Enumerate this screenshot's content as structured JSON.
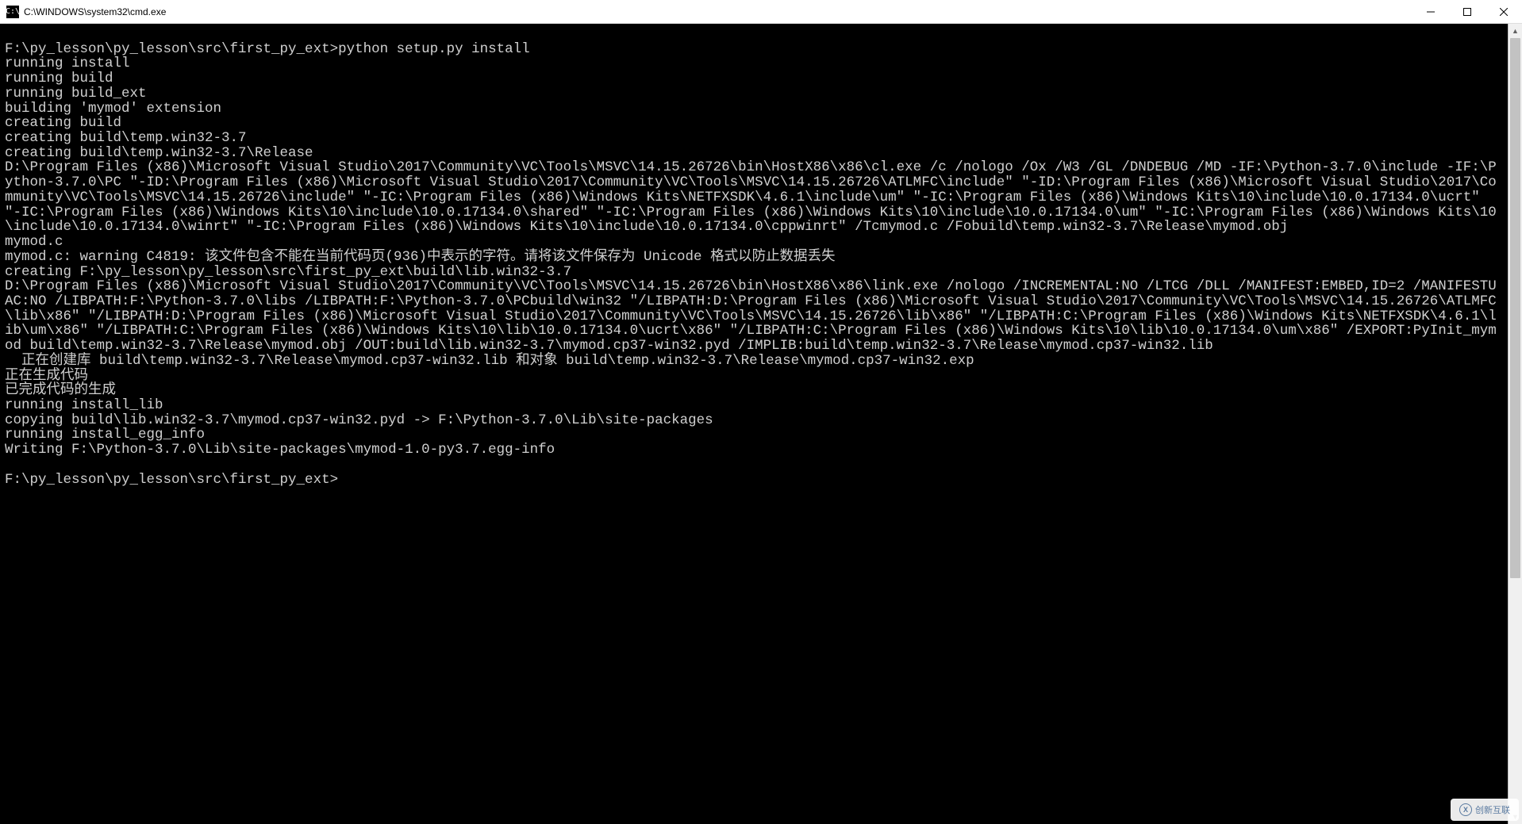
{
  "window": {
    "title": "C:\\WINDOWS\\system32\\cmd.exe",
    "icon_text": "C:\\"
  },
  "terminal": {
    "lines": [
      "",
      "F:\\py_lesson\\py_lesson\\src\\first_py_ext>python setup.py install",
      "running install",
      "running build",
      "running build_ext",
      "building 'mymod' extension",
      "creating build",
      "creating build\\temp.win32-3.7",
      "creating build\\temp.win32-3.7\\Release",
      "D:\\Program Files (x86)\\Microsoft Visual Studio\\2017\\Community\\VC\\Tools\\MSVC\\14.15.26726\\bin\\HostX86\\x86\\cl.exe /c /nologo /Ox /W3 /GL /DNDEBUG /MD -IF:\\Python-3.7.0\\include -IF:\\Python-3.7.0\\PC \"-ID:\\Program Files (x86)\\Microsoft Visual Studio\\2017\\Community\\VC\\Tools\\MSVC\\14.15.26726\\ATLMFC\\include\" \"-ID:\\Program Files (x86)\\Microsoft Visual Studio\\2017\\Community\\VC\\Tools\\MSVC\\14.15.26726\\include\" \"-IC:\\Program Files (x86)\\Windows Kits\\NETFXSDK\\4.6.1\\include\\um\" \"-IC:\\Program Files (x86)\\Windows Kits\\10\\include\\10.0.17134.0\\ucrt\" \"-IC:\\Program Files (x86)\\Windows Kits\\10\\include\\10.0.17134.0\\shared\" \"-IC:\\Program Files (x86)\\Windows Kits\\10\\include\\10.0.17134.0\\um\" \"-IC:\\Program Files (x86)\\Windows Kits\\10\\include\\10.0.17134.0\\winrt\" \"-IC:\\Program Files (x86)\\Windows Kits\\10\\include\\10.0.17134.0\\cppwinrt\" /Tcmymod.c /Fobuild\\temp.win32-3.7\\Release\\mymod.obj",
      "mymod.c",
      "mymod.c: warning C4819: 该文件包含不能在当前代码页(936)中表示的字符。请将该文件保存为 Unicode 格式以防止数据丢失",
      "creating F:\\py_lesson\\py_lesson\\src\\first_py_ext\\build\\lib.win32-3.7",
      "D:\\Program Files (x86)\\Microsoft Visual Studio\\2017\\Community\\VC\\Tools\\MSVC\\14.15.26726\\bin\\HostX86\\x86\\link.exe /nologo /INCREMENTAL:NO /LTCG /DLL /MANIFEST:EMBED,ID=2 /MANIFESTUAC:NO /LIBPATH:F:\\Python-3.7.0\\libs /LIBPATH:F:\\Python-3.7.0\\PCbuild\\win32 \"/LIBPATH:D:\\Program Files (x86)\\Microsoft Visual Studio\\2017\\Community\\VC\\Tools\\MSVC\\14.15.26726\\ATLMFC\\lib\\x86\" \"/LIBPATH:D:\\Program Files (x86)\\Microsoft Visual Studio\\2017\\Community\\VC\\Tools\\MSVC\\14.15.26726\\lib\\x86\" \"/LIBPATH:C:\\Program Files (x86)\\Windows Kits\\NETFXSDK\\4.6.1\\lib\\um\\x86\" \"/LIBPATH:C:\\Program Files (x86)\\Windows Kits\\10\\lib\\10.0.17134.0\\ucrt\\x86\" \"/LIBPATH:C:\\Program Files (x86)\\Windows Kits\\10\\lib\\10.0.17134.0\\um\\x86\" /EXPORT:PyInit_mymod build\\temp.win32-3.7\\Release\\mymod.obj /OUT:build\\lib.win32-3.7\\mymod.cp37-win32.pyd /IMPLIB:build\\temp.win32-3.7\\Release\\mymod.cp37-win32.lib",
      "  正在创建库 build\\temp.win32-3.7\\Release\\mymod.cp37-win32.lib 和对象 build\\temp.win32-3.7\\Release\\mymod.cp37-win32.exp",
      "正在生成代码",
      "已完成代码的生成",
      "running install_lib",
      "copying build\\lib.win32-3.7\\mymod.cp37-win32.pyd -> F:\\Python-3.7.0\\Lib\\site-packages",
      "running install_egg_info",
      "Writing F:\\Python-3.7.0\\Lib\\site-packages\\mymod-1.0-py3.7.egg-info",
      "",
      "F:\\py_lesson\\py_lesson\\src\\first_py_ext>"
    ]
  },
  "watermark": {
    "text": "创新互联"
  }
}
